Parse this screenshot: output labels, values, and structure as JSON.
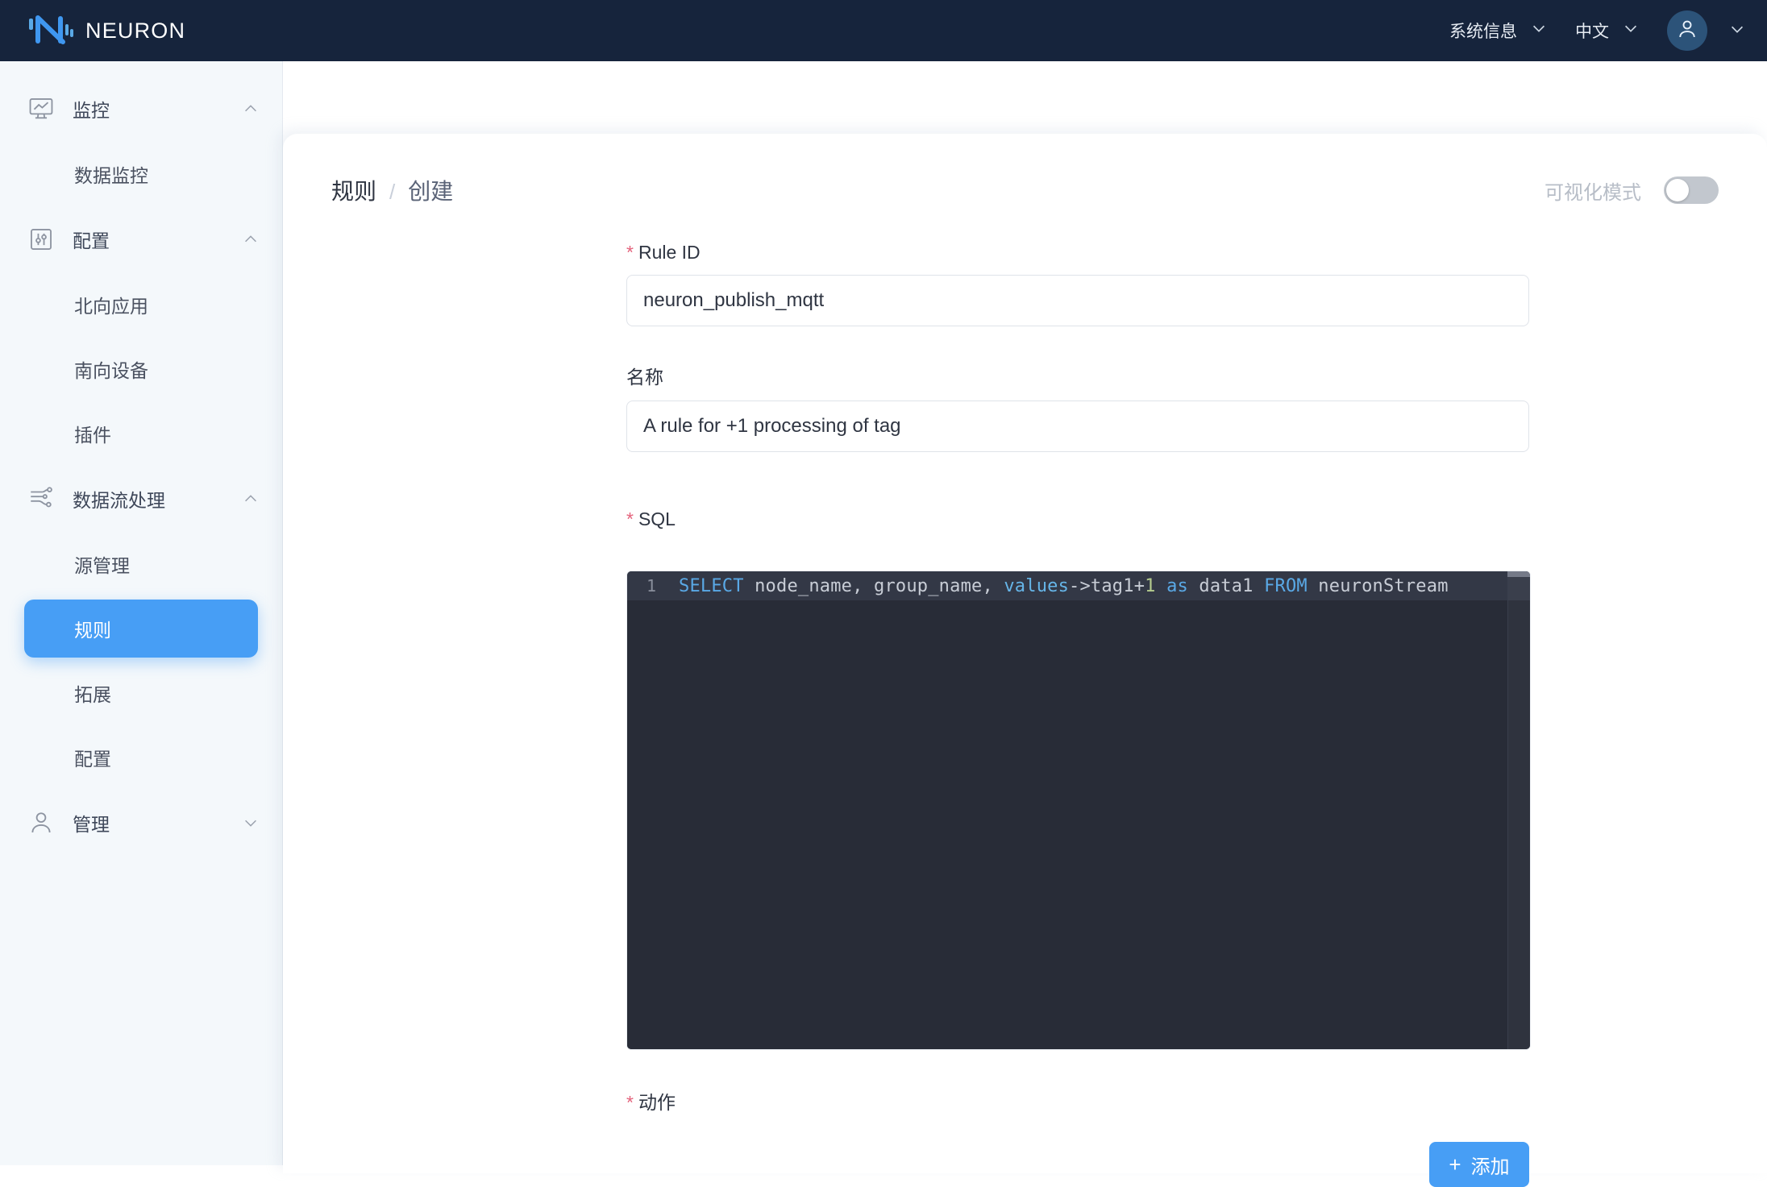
{
  "app": {
    "brand_name": "NEURON",
    "logo_icon": "neuron-logo-icon"
  },
  "header": {
    "system_info_label": "系统信息",
    "system_info_chevron": "chevron-down-icon",
    "language_label": "中文",
    "language_chevron": "chevron-down-icon",
    "avatar_icon": "user-avatar-icon",
    "avatar_chevron": "chevron-down-icon"
  },
  "sidebar": {
    "groups": [
      {
        "label": "监控",
        "icon": "monitor-chart-icon",
        "chevron": "chevron-up-icon",
        "items": [
          {
            "label": "数据监控",
            "active": false
          }
        ]
      },
      {
        "label": "配置",
        "icon": "sliders-icon",
        "chevron": "chevron-up-icon",
        "items": [
          {
            "label": "北向应用",
            "active": false
          },
          {
            "label": "南向设备",
            "active": false
          },
          {
            "label": "插件",
            "active": false
          }
        ]
      },
      {
        "label": "数据流处理",
        "icon": "dataflow-icon",
        "chevron": "chevron-up-icon",
        "items": [
          {
            "label": "源管理",
            "active": false
          },
          {
            "label": "规则",
            "active": true
          },
          {
            "label": "拓展",
            "active": false
          },
          {
            "label": "配置",
            "active": false
          }
        ]
      },
      {
        "label": "管理",
        "icon": "user-icon",
        "chevron": "chevron-down-icon",
        "items": []
      }
    ]
  },
  "content": {
    "breadcrumb": {
      "root": "规则",
      "separator": "/",
      "current": "创建"
    },
    "visual_mode": {
      "label": "可视化模式",
      "enabled": false
    },
    "form": {
      "rule_id": {
        "label": "Rule ID",
        "required": true,
        "value": "neuron_publish_mqtt",
        "placeholder": ""
      },
      "name": {
        "label": "名称",
        "required": false,
        "value": "A rule for +1 processing of tag",
        "placeholder": ""
      },
      "sql": {
        "label": "SQL",
        "required": true,
        "line_number": "1",
        "value": "SELECT node_name, group_name, values->tag1+1 as data1 FROM neuronStream",
        "tokens": [
          {
            "t": "SELECT",
            "c": "kw"
          },
          {
            "t": " node_name, group_name, ",
            "c": "op"
          },
          {
            "t": "values",
            "c": "fn"
          },
          {
            "t": "->tag1+",
            "c": "op"
          },
          {
            "t": "1",
            "c": "num"
          },
          {
            "t": " ",
            "c": "op"
          },
          {
            "t": "as",
            "c": "kw"
          },
          {
            "t": " data1 ",
            "c": "op"
          },
          {
            "t": "FROM",
            "c": "kw"
          },
          {
            "t": " neuronStream",
            "c": "op"
          }
        ]
      },
      "action": {
        "label": "动作",
        "required": true,
        "add_button": {
          "plus": "+",
          "label": "添加"
        }
      }
    }
  },
  "colors": {
    "topbar_bg": "#16243c",
    "sidebar_bg": "#f4f8fb",
    "accent": "#479ef5",
    "required_star": "#e4637c",
    "editor_bg": "#282c37",
    "editor_active_line": "#333846"
  }
}
